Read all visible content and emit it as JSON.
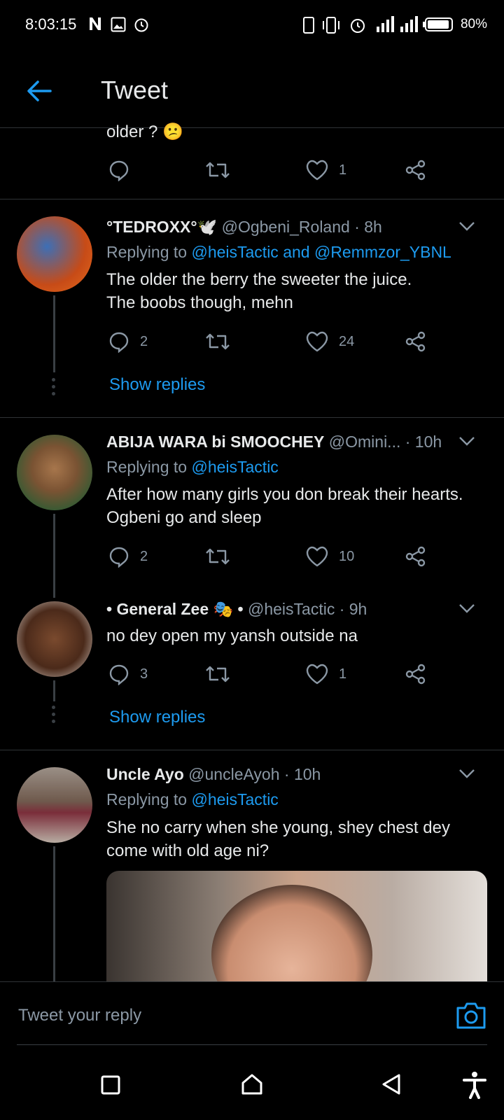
{
  "status_bar": {
    "time": "8:03:15",
    "battery": "80%"
  },
  "header": {
    "title": "Tweet"
  },
  "top_partial": {
    "text": "older ? 😕",
    "likes": "1"
  },
  "tweets": [
    {
      "name": "°TEDROXX°🕊️",
      "handle": "@Ogbeni_Roland",
      "time": "· 8h",
      "replying_label": "Replying to",
      "replying_to": "@heisTactic and @Remmzor_YBNL",
      "text1": "The older the berry the sweeter the juice.",
      "text2": "The boobs though, mehn",
      "replies": "2",
      "likes": "24",
      "show_replies": "Show replies"
    },
    {
      "name": "ABIJA WARA bi SMOOCHEY",
      "handle": "@Omini...",
      "time": "· 10h",
      "replying_label": "Replying to",
      "replying_to": "@heisTactic",
      "text1": "After how many girls you don break their hearts.",
      "text2": "Ogbeni go and sleep",
      "replies": "2",
      "likes": "10"
    },
    {
      "name": "• General Zee 🎭 •",
      "handle": "@heisTactic",
      "time": "· 9h",
      "text1": "no dey open my yansh outside na",
      "replies": "3",
      "likes": "1",
      "show_replies": "Show replies"
    },
    {
      "name": "Uncle Ayo",
      "handle": "@uncleAyoh",
      "time": "· 10h",
      "replying_label": "Replying to",
      "replying_to": "@heisTactic",
      "text1": "She no carry when she young, shey chest dey",
      "text2": "come with old age ni?"
    }
  ],
  "compose": {
    "placeholder": "Tweet your reply"
  },
  "colors": {
    "accent": "#1d9bf0",
    "background": "#000000",
    "muted": "#8b98a5"
  }
}
